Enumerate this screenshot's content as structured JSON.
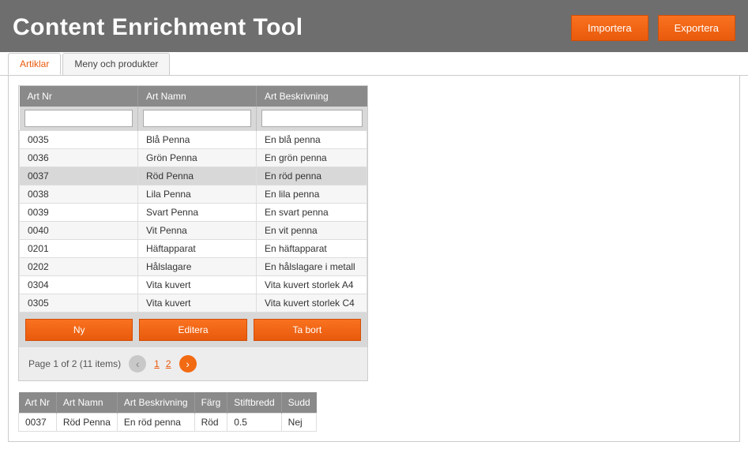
{
  "header": {
    "title": "Content Enrichment Tool",
    "import_label": "Importera",
    "export_label": "Exportera"
  },
  "tabs": [
    {
      "label": "Artiklar",
      "active": true
    },
    {
      "label": "Meny och produkter",
      "active": false
    }
  ],
  "grid": {
    "columns": {
      "artnr": "Art Nr",
      "artnamn": "Art Namn",
      "artbeskr": "Art Beskrivning"
    },
    "filters": {
      "artnr": "",
      "artnamn": "",
      "artbeskr": ""
    },
    "rows": [
      {
        "artnr": "0035",
        "artnamn": "Blå Penna",
        "artbeskr": "En blå penna",
        "selected": false
      },
      {
        "artnr": "0036",
        "artnamn": "Grön Penna",
        "artbeskr": "En grön penna",
        "selected": false
      },
      {
        "artnr": "0037",
        "artnamn": "Röd Penna",
        "artbeskr": "En röd penna",
        "selected": true
      },
      {
        "artnr": "0038",
        "artnamn": "Lila Penna",
        "artbeskr": "En lila penna",
        "selected": false
      },
      {
        "artnr": "0039",
        "artnamn": "Svart Penna",
        "artbeskr": "En svart penna",
        "selected": false
      },
      {
        "artnr": "0040",
        "artnamn": "Vit Penna",
        "artbeskr": "En vit penna",
        "selected": false
      },
      {
        "artnr": "0201",
        "artnamn": "Häftapparat",
        "artbeskr": "En häftapparat",
        "selected": false
      },
      {
        "artnr": "0202",
        "artnamn": "Hålslagare",
        "artbeskr": "En hålslagare i metall",
        "selected": false
      },
      {
        "artnr": "0304",
        "artnamn": "Vita kuvert",
        "artbeskr": "Vita kuvert storlek A4",
        "selected": false
      },
      {
        "artnr": "0305",
        "artnamn": "Vita kuvert",
        "artbeskr": "Vita kuvert storlek C4",
        "selected": false
      }
    ],
    "actions": {
      "new_label": "Ny",
      "edit_label": "Editera",
      "delete_label": "Ta bort"
    },
    "pager": {
      "summary": "Page 1 of 2 (11 items)",
      "pages": [
        "1",
        "2"
      ],
      "current": "1"
    }
  },
  "detail": {
    "columns": {
      "artnr": "Art Nr",
      "artnamn": "Art Namn",
      "artbeskr": "Art Beskrivning",
      "farg": "Färg",
      "stiftbredd": "Stiftbredd",
      "sudd": "Sudd"
    },
    "row": {
      "artnr": "0037",
      "artnamn": "Röd Penna",
      "artbeskr": "En röd penna",
      "farg": "Röd",
      "stiftbredd": "0.5",
      "sudd": "Nej"
    }
  }
}
